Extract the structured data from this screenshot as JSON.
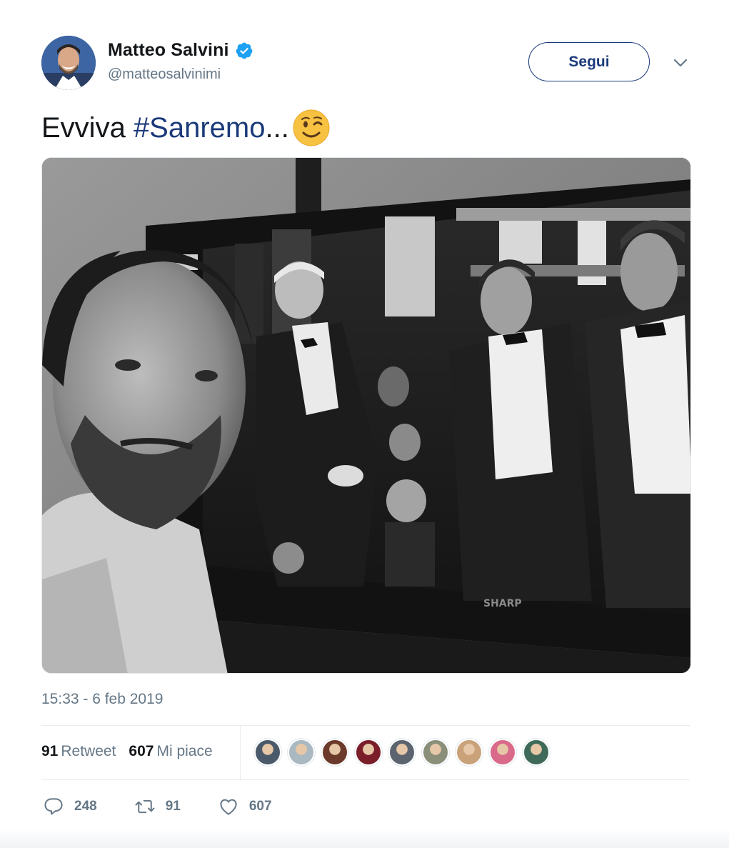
{
  "author": {
    "display_name": "Matteo Salvini",
    "handle": "@matteosalvinimi",
    "verified": true,
    "verified_color": "#1da1f2"
  },
  "follow_button": {
    "label": "Segui"
  },
  "tweet": {
    "text_prefix": "Evviva ",
    "hashtag": "#Sanremo",
    "text_suffix": "...",
    "emoji": "winking-face",
    "timestamp": "15:33 - 6 feb 2019"
  },
  "media": {
    "description_icon": "photo",
    "tv_brand": "SHARP"
  },
  "stats": {
    "retweets_count": "91",
    "retweets_label": "Retweet",
    "likes_count": "607",
    "likes_label": "Mi piace",
    "likers": [
      {
        "color": "#4a5a6a"
      },
      {
        "color": "#aab8c2"
      },
      {
        "color": "#6b3a2a"
      },
      {
        "color": "#7a1e2a"
      },
      {
        "color": "#5c6470"
      },
      {
        "color": "#8a8f7a"
      },
      {
        "color": "#c9a27a"
      },
      {
        "color": "#d96a8a"
      },
      {
        "color": "#3f6a5a"
      }
    ]
  },
  "actions": {
    "reply_count": "248",
    "retweet_count": "91",
    "like_count": "607"
  },
  "colors": {
    "link": "#1b3a7a",
    "muted": "#657786",
    "text": "#14171a"
  }
}
